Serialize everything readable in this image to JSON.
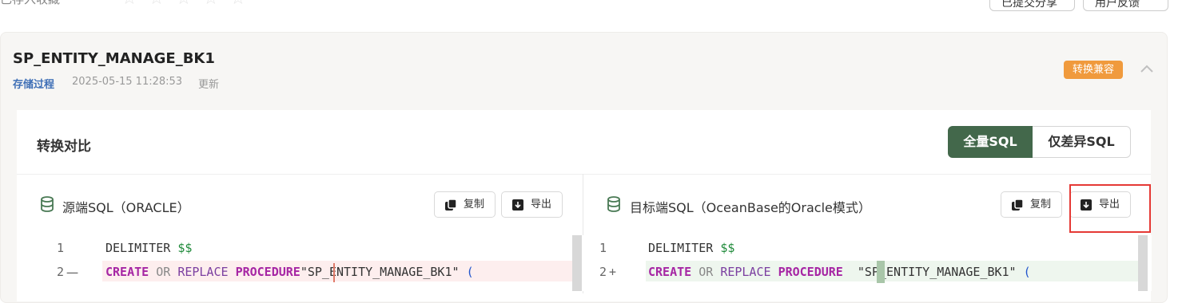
{
  "top": {
    "rating_label": "已存入收藏",
    "stars": [
      "☆",
      "☆",
      "☆",
      "☆",
      "☆"
    ],
    "btn_share": "已提交分享",
    "btn_feedback": "用户反馈"
  },
  "card": {
    "title": "SP_ENTITY_MANAGE_BK1",
    "type": "存储过程",
    "timestamp": "2025-05-15 11:28:53",
    "update_label": "更新",
    "badge": "转换兼容",
    "colors": {
      "badge": "#f09a3d",
      "type": "#3f6fb6"
    }
  },
  "compare": {
    "title": "转换对比",
    "seg_full": "全量SQL",
    "seg_diff": "仅差异SQL",
    "active_color": "#43684b"
  },
  "source": {
    "label": "源端SQL（ORACLE）",
    "copy": "复制",
    "export": "导出",
    "lines": [
      {
        "num": "1",
        "mark": ""
      },
      {
        "num": "2",
        "mark": "一"
      }
    ]
  },
  "target": {
    "label": "目标端SQL（OceanBase的Oracle模式）",
    "copy": "复制",
    "export": "导出",
    "lines": [
      {
        "num": "1",
        "mark": ""
      },
      {
        "num": "2",
        "mark": "+"
      }
    ]
  },
  "code": {
    "line1_kw": "DELIMITER",
    "line1_tail": "$$",
    "create": "CREATE",
    "or": "OR",
    "replace": "REPLACE",
    "procedure": "PROCEDURE",
    "name": "\"SP_ENTITY_MANAGE_BK1\"",
    "paren": "("
  }
}
